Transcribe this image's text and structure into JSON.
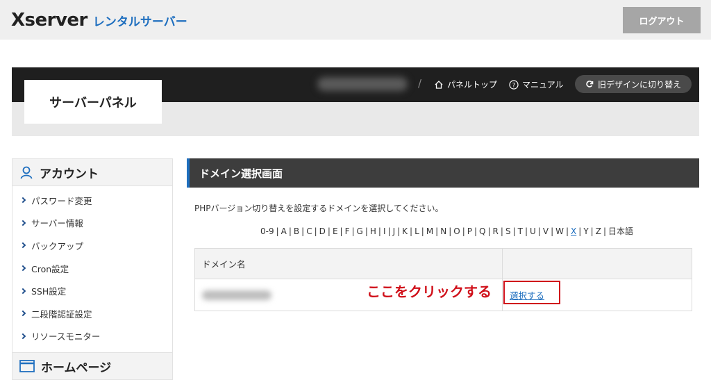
{
  "header": {
    "logo_brand": "Xserver",
    "logo_sub": "レンタルサーバー",
    "logout_label": "ログアウト"
  },
  "panel": {
    "title": "サーバーパネル",
    "breadcrumb_separator": "/",
    "nav": {
      "panel_top": "パネルトップ",
      "manual": "マニュアル",
      "old_design": "旧デザインに切り替え"
    }
  },
  "sidebar": {
    "account_title": "アカウント",
    "items": [
      {
        "label": "パスワード変更"
      },
      {
        "label": "サーバー情報"
      },
      {
        "label": "バックアップ"
      },
      {
        "label": "Cron設定"
      },
      {
        "label": "SSH設定"
      },
      {
        "label": "二段階認証設定"
      },
      {
        "label": "リソースモニター"
      }
    ],
    "homepage_title": "ホームページ"
  },
  "main": {
    "title": "ドメイン選択画面",
    "instruction": "PHPバージョン切り替えを設定するドメインを選択してください。",
    "alpha_index": [
      "0-9",
      "A",
      "B",
      "C",
      "D",
      "E",
      "F",
      "G",
      "H",
      "I",
      "J",
      "K",
      "L",
      "M",
      "N",
      "O",
      "P",
      "Q",
      "R",
      "S",
      "T",
      "U",
      "V",
      "W",
      "X",
      "Y",
      "Z",
      "日本語"
    ],
    "alpha_active": "X",
    "table": {
      "header_domain": "ドメイン名",
      "header_action": "",
      "select_label": "選択する"
    },
    "annotation": "ここをクリックする"
  },
  "colors": {
    "brand_blue": "#1f6fbf",
    "annotation_red": "#d0101a",
    "dark_band": "#1f1f1f"
  }
}
